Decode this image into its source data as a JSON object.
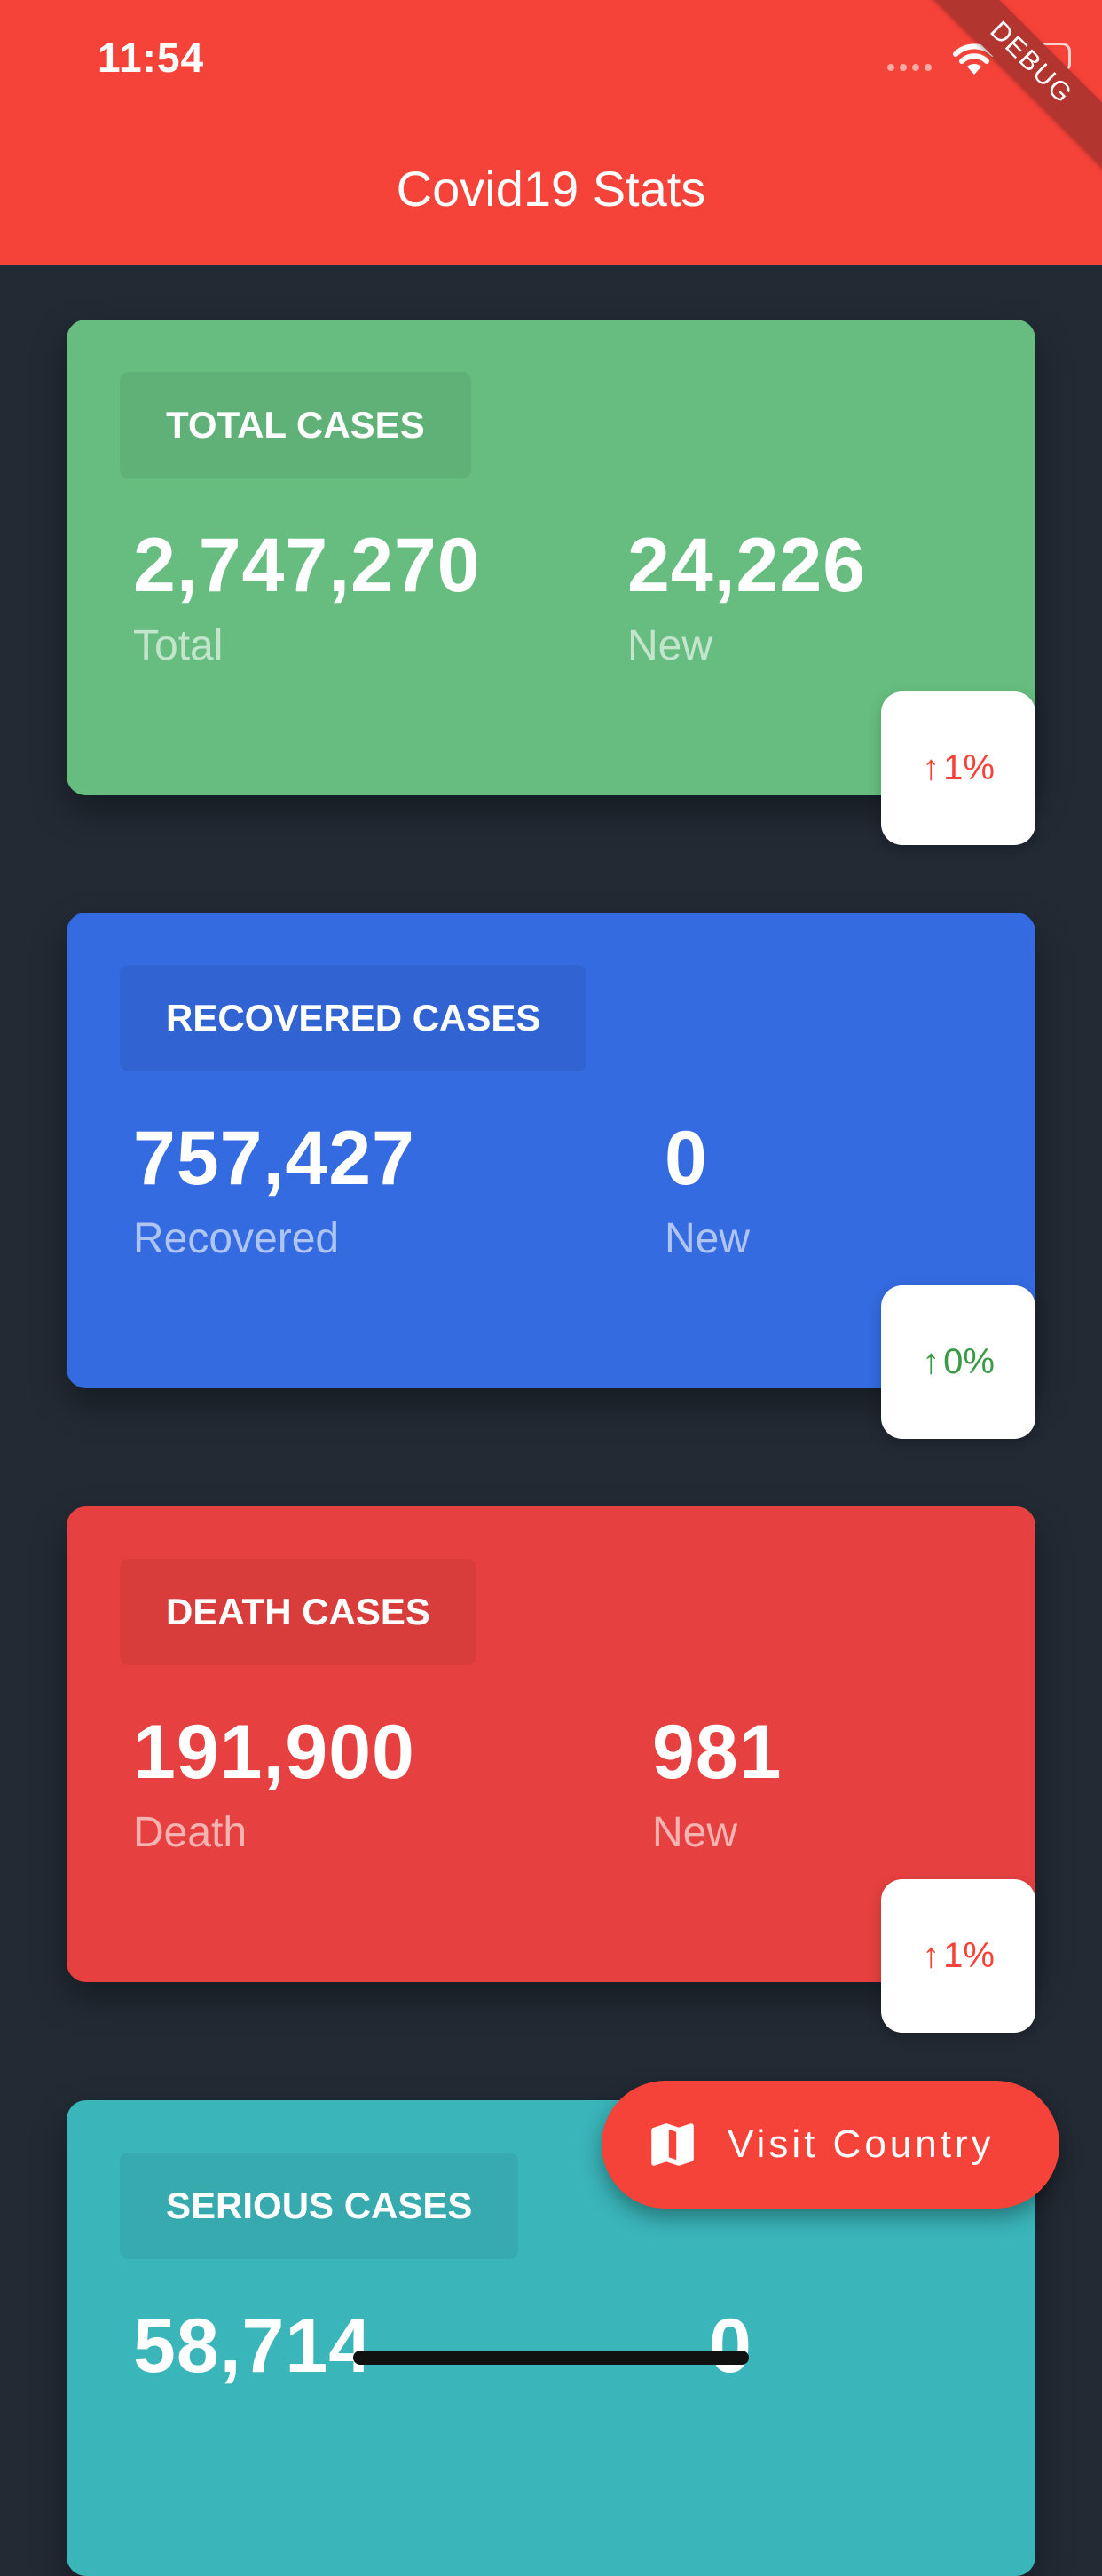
{
  "status_bar": {
    "time": "11:54"
  },
  "debug_banner": "DEBUG",
  "app_bar": {
    "title": "Covid19 Stats"
  },
  "cards": [
    {
      "label": "TOTAL CASES",
      "total": "2,747,270",
      "total_label": "Total",
      "new": "24,226",
      "new_label": "New",
      "change": "1%",
      "color": "#66bd7f",
      "change_color": "#f54339"
    },
    {
      "label": "RECOVERED CASES",
      "total": "757,427",
      "total_label": "Recovered",
      "new": "0",
      "new_label": "New",
      "change": "0%",
      "color": "#356be0",
      "change_color": "#3a9b47"
    },
    {
      "label": "DEATH CASES",
      "total": "191,900",
      "total_label": "Death",
      "new": "981",
      "new_label": "New",
      "change": "1%",
      "color": "#e64140",
      "change_color": "#f54339"
    },
    {
      "label": "SERIOUS CASES",
      "total": "58,714",
      "new": "0",
      "color": "#3ab5b9"
    }
  ],
  "fab": {
    "label": "Visit Country",
    "icon": "map-icon"
  }
}
